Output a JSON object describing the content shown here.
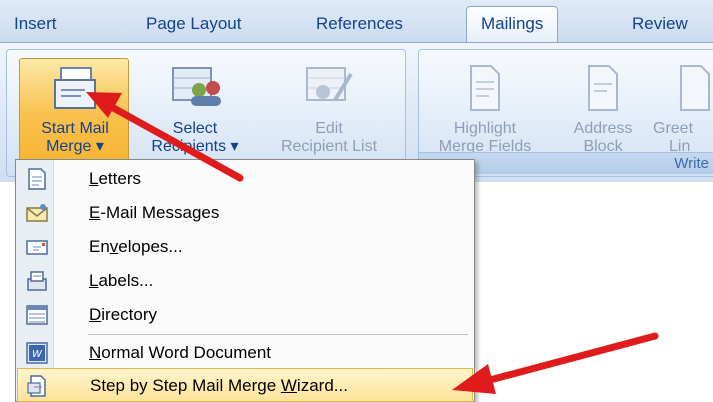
{
  "tabs": [
    "Insert",
    "Page Layout",
    "References",
    "Mailings",
    "Review"
  ],
  "active_tab": "Mailings",
  "ribbon": {
    "start_mail_merge": [
      "Start Mail",
      "Merge ▾"
    ],
    "select_recipients": [
      "Select",
      "Recipients ▾"
    ],
    "edit_recipient_list": [
      "Edit",
      "Recipient List"
    ],
    "highlight_merge_fields": [
      "Highlight",
      "Merge Fields"
    ],
    "address_block": [
      "Address",
      "Block"
    ],
    "greeting_line": [
      "Greet",
      "Lin"
    ],
    "write_group_label": "Write"
  },
  "menu": {
    "items": [
      {
        "pre": "",
        "u": "L",
        "post": "etters",
        "icon": "letter-icon"
      },
      {
        "pre": "",
        "u": "E",
        "post": "-Mail Messages",
        "icon": "email-envelope-icon"
      },
      {
        "pre": "En",
        "u": "v",
        "post": "elopes...",
        "icon": "envelope-icon"
      },
      {
        "pre": "",
        "u": "L",
        "post": "abels...",
        "icon": "labels-icon"
      },
      {
        "pre": "",
        "u": "D",
        "post": "irectory",
        "icon": "directory-icon"
      },
      {
        "pre": "",
        "u": "N",
        "post": "ormal Word Document",
        "icon": "word-document-icon"
      },
      {
        "pre": "Step by Step Mail Merge ",
        "u": "W",
        "post": "izard...",
        "icon": "wizard-icon"
      }
    ]
  },
  "colors": {
    "accent_text": "#15428b",
    "highlight": "#fde49a",
    "arrow": "#e01b1b"
  }
}
